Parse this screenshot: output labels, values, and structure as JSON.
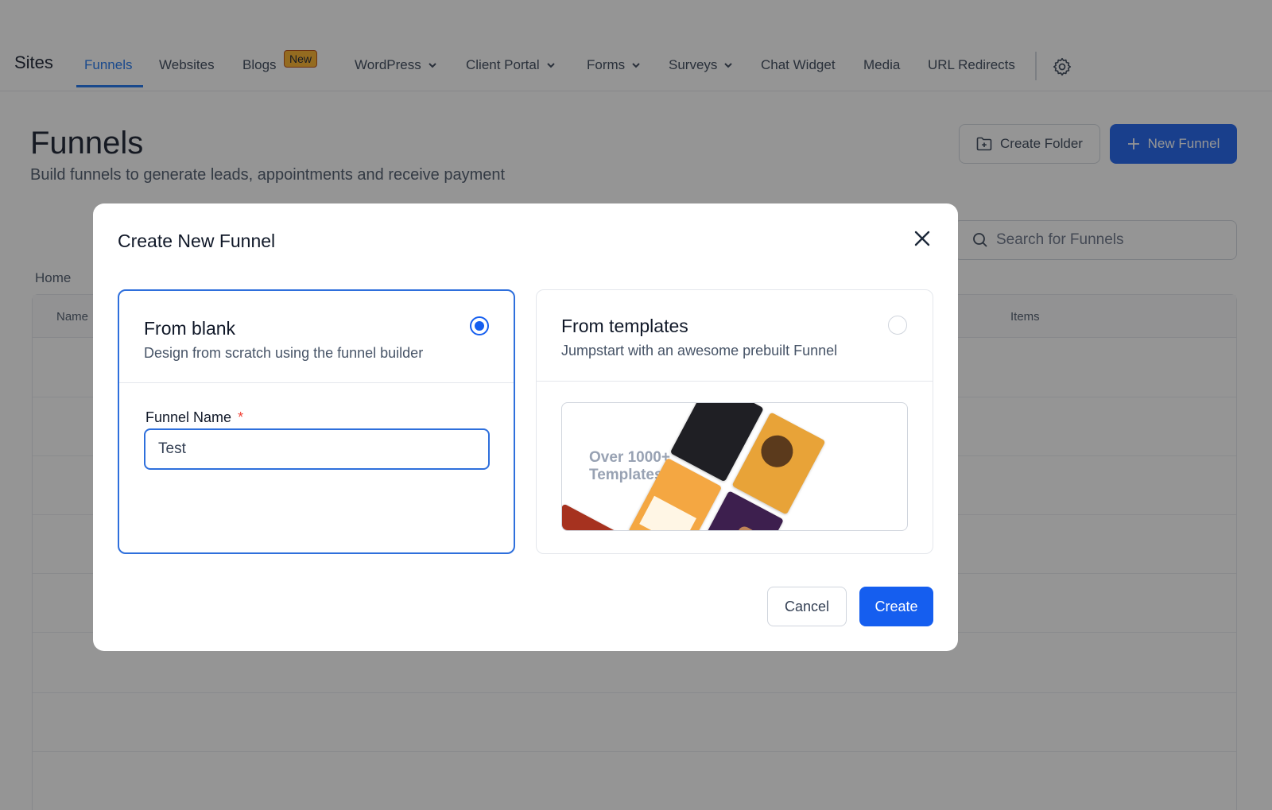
{
  "nav": {
    "brand": "Sites",
    "items": [
      {
        "label": "Funnels"
      },
      {
        "label": "Websites"
      },
      {
        "label": "Blogs"
      },
      {
        "label": "WordPress"
      },
      {
        "label": "Client Portal"
      },
      {
        "label": "Forms"
      },
      {
        "label": "Surveys"
      },
      {
        "label": "Chat Widget"
      },
      {
        "label": "Media"
      },
      {
        "label": "URL Redirects"
      }
    ],
    "blogs_badge": "New",
    "active": "Funnels",
    "settings_icon": "gear-icon"
  },
  "page": {
    "title": "Funnels",
    "subtitle": "Build funnels to generate leads, appointments and receive payment",
    "create_folder_label": "Create Folder",
    "new_funnel_label": "New Funnel",
    "search_placeholder": "Search for Funnels",
    "breadcrumb": "Home",
    "table_headers": {
      "name": "Name",
      "items": "Items"
    }
  },
  "modal": {
    "title": "Create New Funnel",
    "options": {
      "blank": {
        "title": "From blank",
        "description": "Design from scratch using the funnel builder",
        "selected": true
      },
      "templates": {
        "title": "From templates",
        "description": "Jumpstart with an awesome prebuilt Funnel",
        "preview_text": "Over 1000+ Templates",
        "selected": false
      }
    },
    "field": {
      "label": "Funnel Name",
      "required_mark": "*",
      "value": "Test"
    },
    "cancel_label": "Cancel",
    "create_label": "Create"
  },
  "colors": {
    "primary": "#155eef",
    "active_nav": "#1570ef",
    "badge": "#fdb022",
    "required": "#f04438"
  }
}
